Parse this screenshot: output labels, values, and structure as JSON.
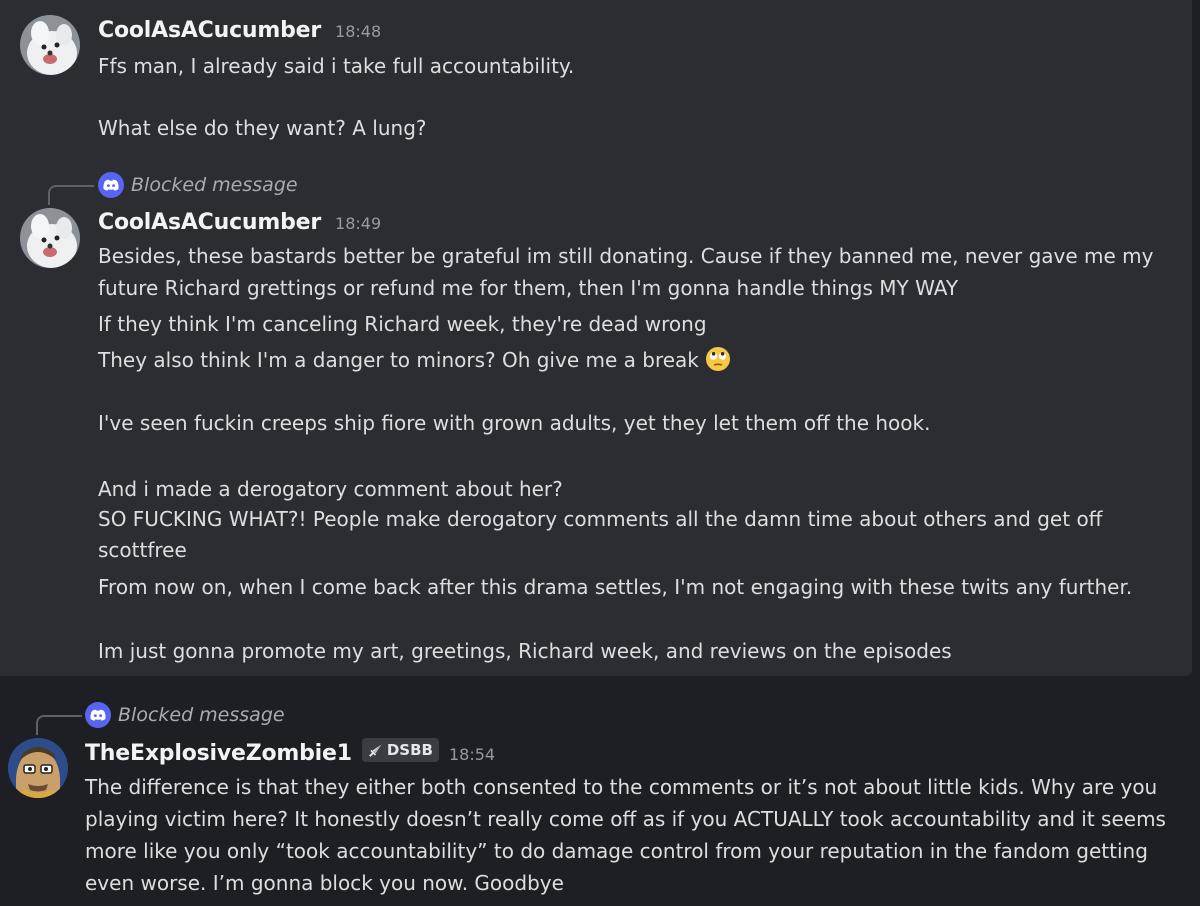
{
  "messages": [
    {
      "author": "CoolAsACucumber",
      "time": "18:48",
      "lines": [
        "Ffs man, I already said i take full accountability.",
        "What else do they want? A lung?"
      ]
    },
    {
      "reply": {
        "text": "Blocked message",
        "icon": "discord-logo-icon"
      },
      "author": "CoolAsACucumber",
      "time": "18:49",
      "lines": [
        "Besides, these bastards better be grateful im still donating. Cause if they banned me, never gave me my",
        "future Richard grettings or refund me for them, then I'm gonna handle things MY WAY",
        "If they think I'm canceling Richard week, they're dead wrong",
        "They also think I'm a danger to minors? Oh give me a break",
        "I've seen fuckin creeps ship fiore with grown adults, yet they let them off the hook.",
        "And i made a derogatory comment about her?",
        "SO FUCKING WHAT?! People make derogatory comments all the damn time about others and get off",
        "scottfree",
        "From now on, when I come back after this drama settles, I'm not engaging with these twits any further.",
        "Im just gonna promote my art, greetings, Richard week, and reviews on the episodes"
      ],
      "emoji": "face-with-rolling-eyes-emoji"
    },
    {
      "reply": {
        "text": "Blocked message",
        "icon": "discord-logo-icon"
      },
      "author": "TheExplosiveZombie1",
      "badge": {
        "icon": "sword-icon",
        "text": "DSBB"
      },
      "time": "18:54",
      "lines": [
        "The difference is that they either both consented to the comments or it’s not about little kids. Why are you",
        "playing victim here? It honestly doesn’t really come off as if you ACTUALLY took accountability and it seems",
        "more like you only “took accountability” to do damage control from your reputation in the fandom getting",
        "even worse. I’m gonna block you now. Goodbye"
      ]
    }
  ],
  "colors": {
    "background": "#1e1f24",
    "highlight": "#2c2d33",
    "username": "#f2f3f5",
    "text": "#dcdee2",
    "timestamp": "#949ba4",
    "discord_blurple": "#5865f2"
  }
}
